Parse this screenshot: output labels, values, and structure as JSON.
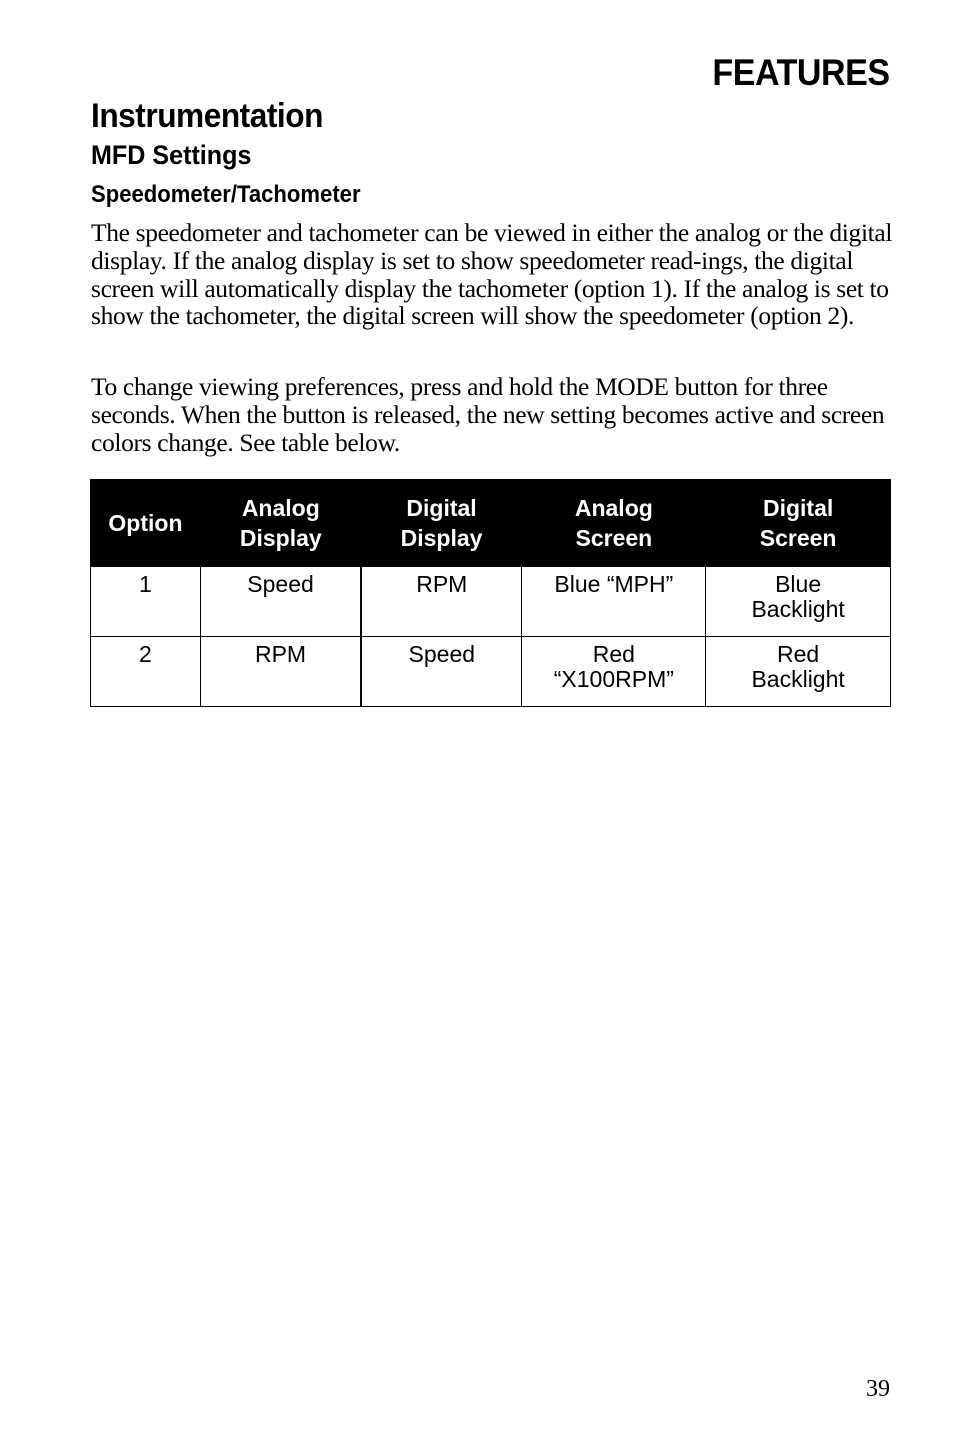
{
  "section_header": "FEATURES",
  "heading": "Instrumentation",
  "subheading": "MFD Settings",
  "subsubheading": "Speedometer/Tachometer",
  "paragraphs": [
    "The speedometer and tachometer can be viewed in either the analog or the digital display. If the analog display is set to show speedometer read-ings, the digital screen will automatically display the tachometer (option 1). If the analog is set to show the tachometer, the digital screen will show the speedometer (option 2).",
    "To change viewing preferences, press and hold the MODE button for three seconds. When the button is released, the new setting becomes active and screen colors change. See table below."
  ],
  "table": {
    "headers": [
      [
        "Option"
      ],
      [
        "Analog",
        "Display"
      ],
      [
        "Digital",
        "Display"
      ],
      [
        "Analog",
        "Screen"
      ],
      [
        "Digital",
        "Screen"
      ]
    ],
    "rows": [
      {
        "option": "1",
        "analog_display": "Speed",
        "digital_display": "RPM",
        "analog_screen": [
          "Blue “MPH”"
        ],
        "digital_screen": [
          "Blue",
          "Backlight"
        ]
      },
      {
        "option": "2",
        "analog_display": "RPM",
        "digital_display": "Speed",
        "analog_screen": [
          "Red",
          "“X100RPM”"
        ],
        "digital_screen": [
          "Red",
          "Backlight"
        ]
      }
    ]
  },
  "page_number": "39"
}
